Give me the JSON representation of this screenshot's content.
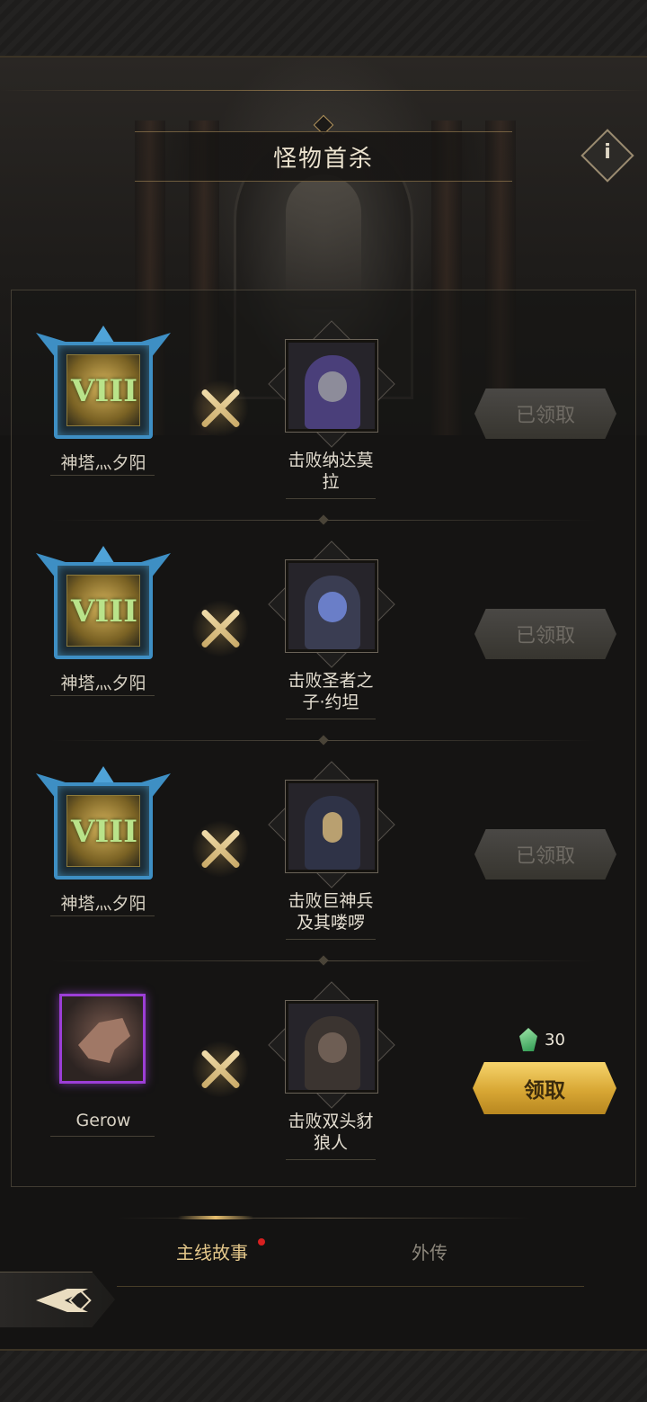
{
  "header": {
    "title": "怪物首杀",
    "help_icon": "info-icon"
  },
  "rows": [
    {
      "left_type": "stage-emblem",
      "left_numeral": "VIII",
      "left_label": "神塔灬夕阳",
      "boss_label": "击败纳达莫\n拉",
      "button_label": "已领取",
      "state": "claimed",
      "boss_color": "#4a3f7a"
    },
    {
      "left_type": "stage-emblem",
      "left_numeral": "VIII",
      "left_label": "神塔灬夕阳",
      "boss_label": "击败圣者之\n子·约坦",
      "button_label": "已领取",
      "state": "claimed",
      "boss_color": "#3a3d52"
    },
    {
      "left_type": "stage-emblem",
      "left_numeral": "VIII",
      "left_label": "神塔灬夕阳",
      "boss_label": "击败巨神兵\n及其喽啰",
      "button_label": "已领取",
      "state": "claimed",
      "boss_color": "#2f3347"
    },
    {
      "left_type": "portrait",
      "left_label": "Gerow",
      "boss_label": "击败双头豺\n狼人",
      "button_label": "领取",
      "state": "claimable",
      "reward_icon": "green-gem-icon",
      "reward_count": "30",
      "boss_color": "#3b3430"
    }
  ],
  "tabs": [
    {
      "label": "主线故事",
      "active": true,
      "notification": true
    },
    {
      "label": "外传",
      "active": false,
      "notification": false
    }
  ],
  "footer": {
    "back_icon": "back-arrow-icon"
  },
  "colors": {
    "accent_gold": "#e4c78a",
    "claim_button": "#d8a734",
    "claimed_button": "#3f3d39",
    "notification_dot": "#d82020",
    "stage_frame": "#3e8fc4",
    "portrait_frame": "#9c3ed6"
  }
}
